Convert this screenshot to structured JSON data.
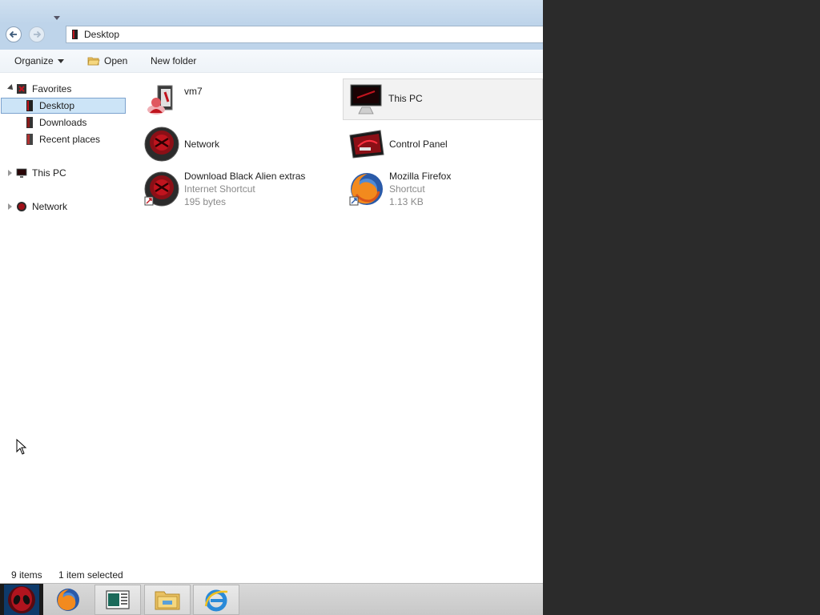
{
  "address": {
    "location": "Desktop",
    "back_icon": "back-arrow-icon",
    "forward_icon": "forward-arrow-icon"
  },
  "toolbar": {
    "organize_label": "Organize",
    "open_label": "Open",
    "new_folder_label": "New folder"
  },
  "navigation": {
    "favorites": {
      "label": "Favorites",
      "items": [
        {
          "label": "Desktop",
          "icon": "desktop-icon",
          "selected": true
        },
        {
          "label": "Downloads",
          "icon": "downloads-icon"
        },
        {
          "label": "Recent places",
          "icon": "recent-places-icon"
        }
      ]
    },
    "this_pc": {
      "label": "This PC",
      "icon": "computer-icon"
    },
    "network": {
      "label": "Network",
      "icon": "network-icon"
    }
  },
  "items": [
    {
      "name": "vm7",
      "icon": "user-folder-icon"
    },
    {
      "name": "This PC",
      "icon": "computer-icon",
      "selected": true
    },
    {
      "name": "Network",
      "icon": "network-icon"
    },
    {
      "name": "Control Panel",
      "icon": "control-panel-icon"
    },
    {
      "name": "Download Black Alien extras",
      "type": "Internet Shortcut",
      "size": "195 bytes",
      "icon": "internet-shortcut-icon"
    },
    {
      "name": "Mozilla Firefox",
      "type": "Shortcut",
      "size": "1.13 KB",
      "icon": "firefox-icon"
    }
  ],
  "status": {
    "item_count": "9 items",
    "selection": "1 item selected"
  },
  "taskbar": {
    "buttons": [
      "start-alien-icon",
      "firefox-icon",
      "document-viewer-icon",
      "file-explorer-icon",
      "internet-explorer-icon"
    ]
  },
  "colors": {
    "accent_red": "#c0141e",
    "selection_blue": "#cce4f7",
    "titlebar": "#bed4ea"
  }
}
